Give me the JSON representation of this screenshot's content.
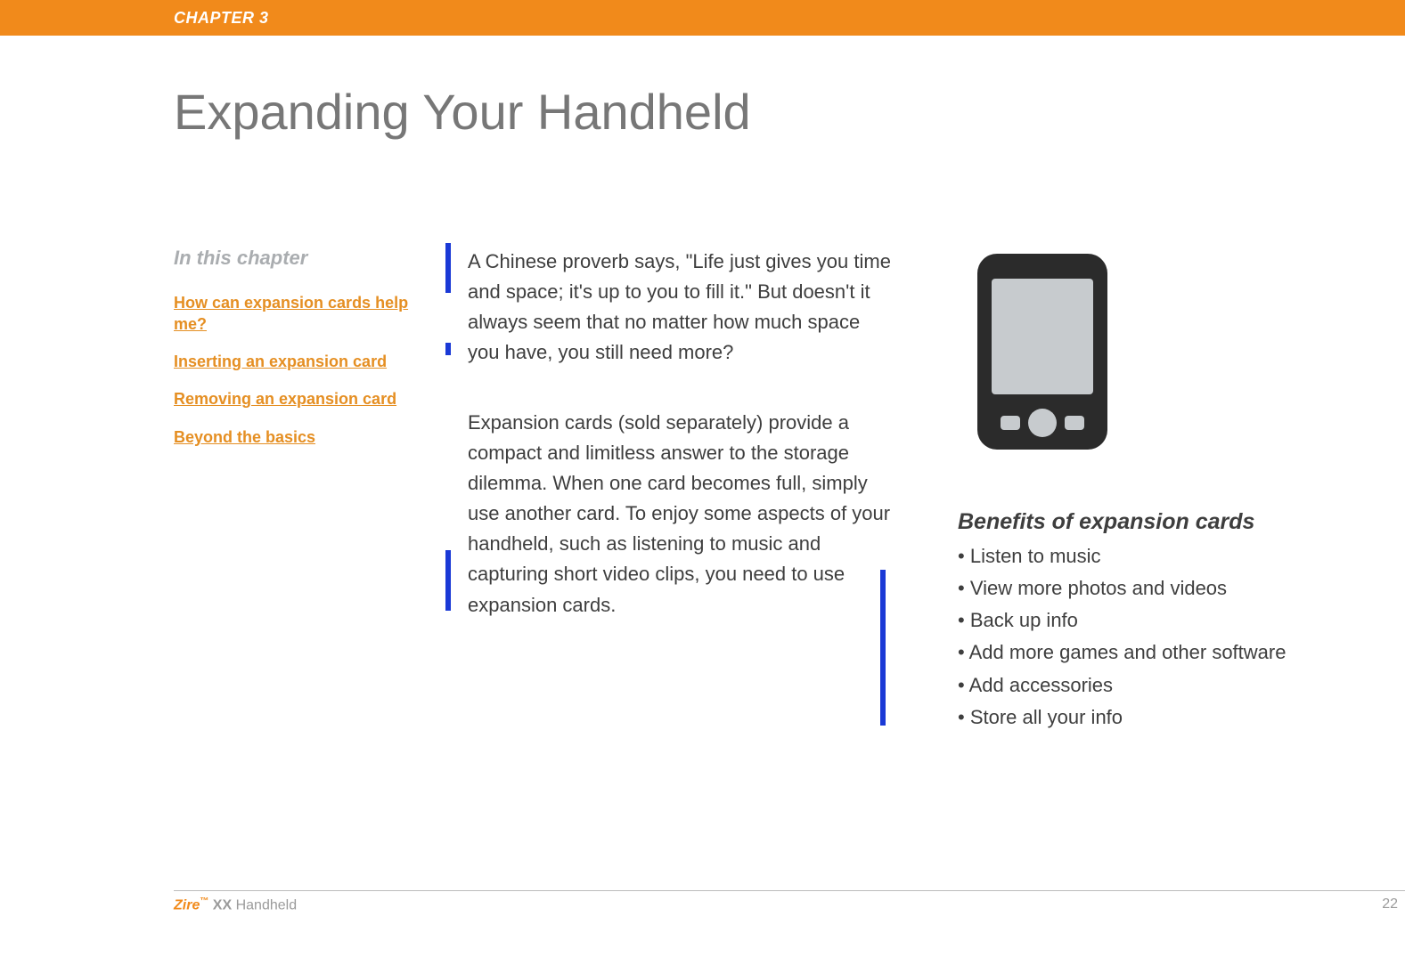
{
  "header": {
    "chapter_label": "CHAPTER 3"
  },
  "title": "Expanding Your Handheld",
  "toc": {
    "heading": "In this chapter",
    "links": [
      "How can expansion cards help me?",
      "Inserting an expansion card",
      "Removing an expansion card",
      "Beyond the basics"
    ]
  },
  "body": {
    "p1": "A Chinese proverb says, \"Life just gives you time and space; it's up to you to fill it.\" But doesn't it always seem that no matter how much space you have, you still need more?",
    "p2": "Expansion cards (sold separately) provide a compact and limitless answer to the storage dilemma. When one card becomes full, simply use another card. To enjoy some aspects of your handheld, such as listening to music and capturing short video clips, you need to use expansion cards."
  },
  "benefits": {
    "heading": "Benefits of expansion cards",
    "items": [
      "Listen to music",
      "View more photos and videos",
      "Back up info",
      "Add more games and other software",
      "Add accessories",
      "Store all your info"
    ]
  },
  "footer": {
    "brand": "Zire",
    "tm": "™",
    "model": " XX",
    "product_desc": " Handheld",
    "page_number": "22"
  }
}
